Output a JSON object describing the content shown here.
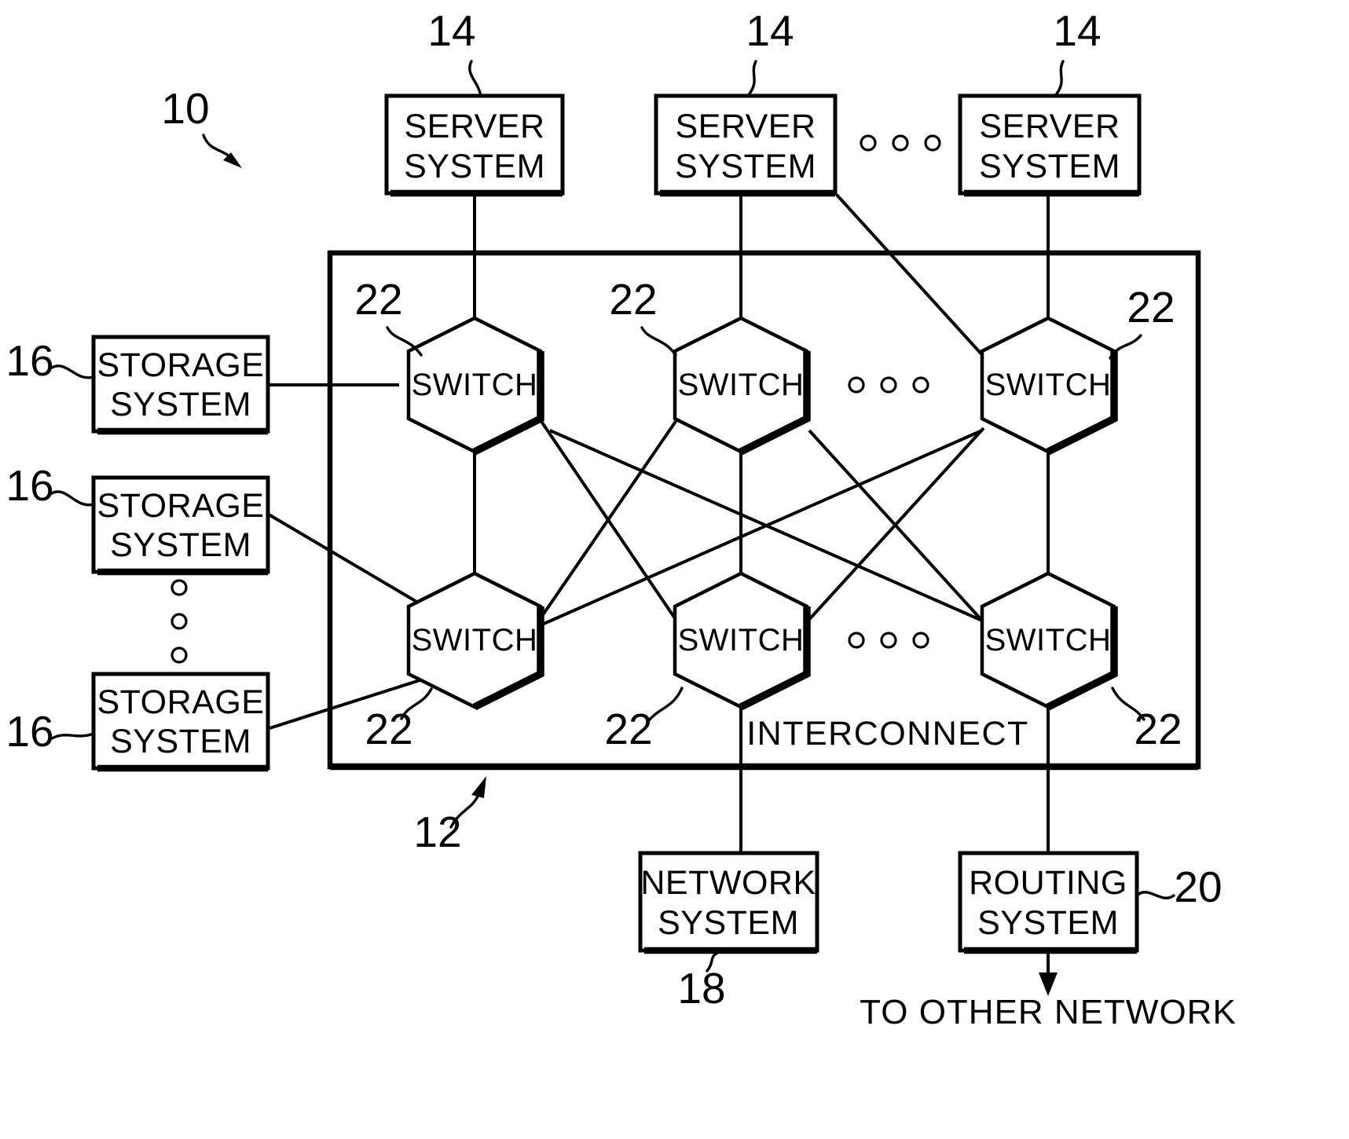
{
  "figure": {
    "label_10": "10",
    "label_12": "12",
    "label_18": "18",
    "label_20": "20",
    "interconnect_label": "INTERCONNECT",
    "to_other_network": "TO OTHER NETWORK"
  },
  "servers": {
    "ref": "14",
    "items": [
      {
        "line1": "SERVER",
        "line2": "SYSTEM",
        "ref": "14"
      },
      {
        "line1": "SERVER",
        "line2": "SYSTEM",
        "ref": "14"
      },
      {
        "line1": "SERVER",
        "line2": "SYSTEM",
        "ref": "14"
      }
    ]
  },
  "storage": {
    "ref": "16",
    "items": [
      {
        "line1": "STORAGE",
        "line2": "SYSTEM",
        "ref": "16"
      },
      {
        "line1": "STORAGE",
        "line2": "SYSTEM",
        "ref": "16"
      },
      {
        "line1": "STORAGE",
        "line2": "SYSTEM",
        "ref": "16"
      }
    ]
  },
  "switches": {
    "ref": "22",
    "label": "SWITCH",
    "top_row": [
      {
        "label": "SWITCH",
        "ref": "22"
      },
      {
        "label": "SWITCH",
        "ref": "22"
      },
      {
        "label": "SWITCH",
        "ref": "22"
      }
    ],
    "bottom_row": [
      {
        "label": "SWITCH",
        "ref": "22"
      },
      {
        "label": "SWITCH",
        "ref": "22"
      },
      {
        "label": "SWITCH",
        "ref": "22"
      }
    ]
  },
  "network_system": {
    "line1": "NETWORK",
    "line2": "SYSTEM",
    "ref": "18"
  },
  "routing_system": {
    "line1": "ROUTING",
    "line2": "SYSTEM",
    "ref": "20"
  },
  "colors": {
    "ink": "#000000",
    "paper": "#ffffff"
  }
}
